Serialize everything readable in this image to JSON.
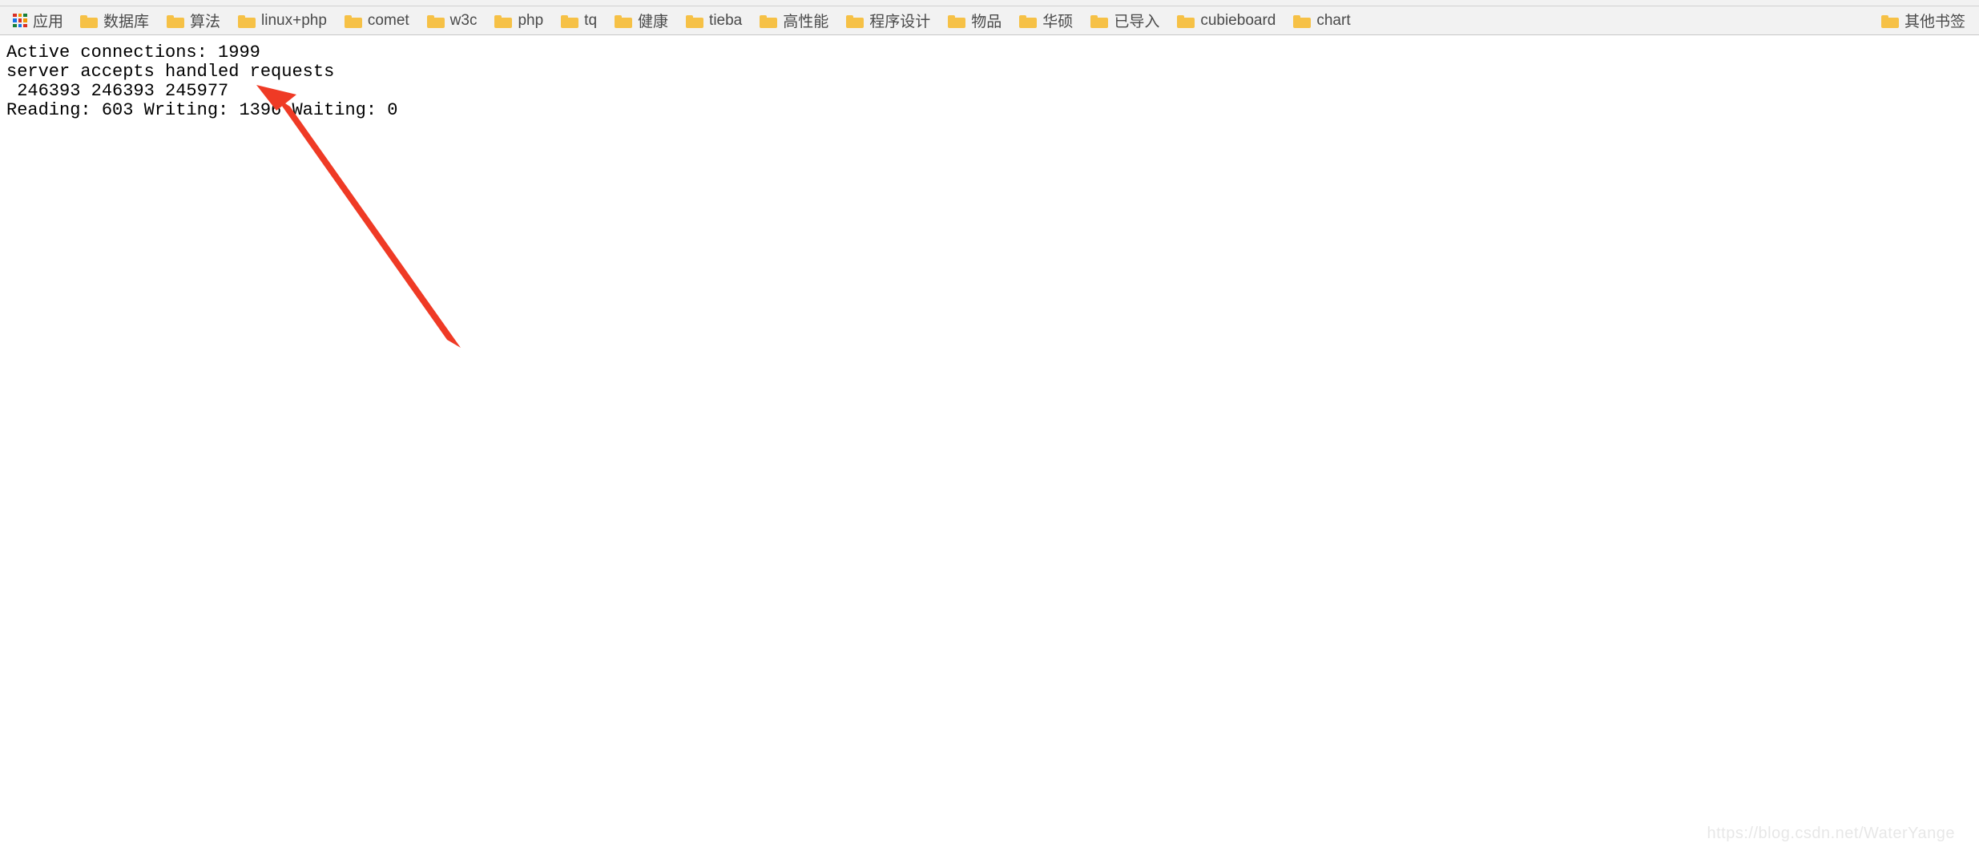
{
  "toolbar": {
    "apps_label": "应用",
    "bookmarks": [
      {
        "label": "数据库"
      },
      {
        "label": "算法"
      },
      {
        "label": "linux+php"
      },
      {
        "label": "comet"
      },
      {
        "label": "w3c"
      },
      {
        "label": "php"
      },
      {
        "label": "tq"
      },
      {
        "label": "健康"
      },
      {
        "label": "tieba"
      },
      {
        "label": "高性能"
      },
      {
        "label": "程序设计"
      },
      {
        "label": "物品"
      },
      {
        "label": "华硕"
      },
      {
        "label": "已导入"
      },
      {
        "label": "cubieboard"
      },
      {
        "label": "chart"
      }
    ],
    "other_label": "其他书签"
  },
  "page": {
    "line1": "Active connections: 1999 ",
    "line2": "server accepts handled requests",
    "line3": " 246393 246393 245977 ",
    "line4": "Reading: 603 Writing: 1396 Waiting: 0 "
  },
  "watermark": "https://blog.csdn.net/WaterYange"
}
